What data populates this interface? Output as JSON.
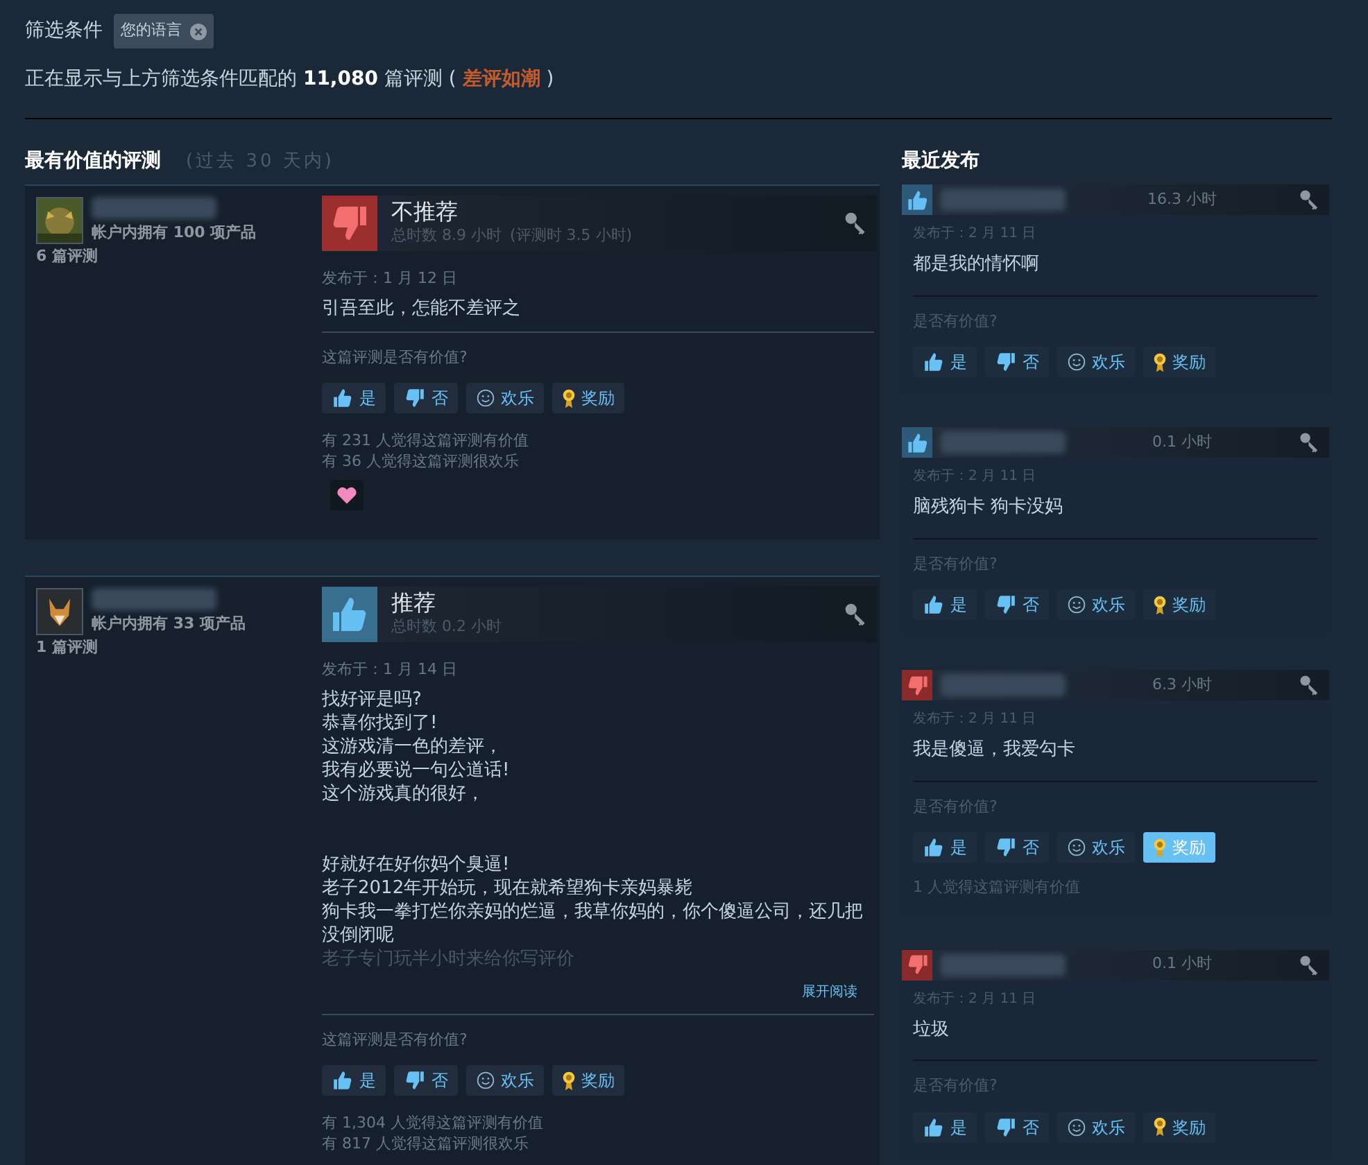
{
  "filter": {
    "label": "筛选条件",
    "chip": "您的语言"
  },
  "summary": {
    "before": "正在显示与上方筛选条件匹配的",
    "count": "11,080",
    "after": "篇评测 (",
    "rating": "差评如潮",
    "close": ")"
  },
  "helpful": {
    "title": "最有价值的评测",
    "period": "(过去 30 天内)",
    "reviews": [
      {
        "products": "帐户内拥有 100 项产品",
        "reviews_count": "6 篇评测",
        "avatar": {
          "kind": "picture"
        },
        "recommended": false,
        "verdict": "不推荐",
        "hours": "总时数 8.9 小时",
        "hours_at_review": "(评测时 3.5 小时)",
        "posted": "发布于：1 月 12 日",
        "paragraphs": [
          [
            "引吾至此，怎能不差评之"
          ]
        ],
        "collapsed": false,
        "question": "这篇评测是否有价值?",
        "votes": [
          {
            "kind": "yes",
            "label": "是",
            "selected": false
          },
          {
            "kind": "no",
            "label": "否",
            "selected": false
          },
          {
            "kind": "funny",
            "label": "欢乐",
            "selected": false
          },
          {
            "kind": "award",
            "label": "奖励",
            "selected": false
          }
        ],
        "stats": [
          "有 231 人觉得这篇评测有价值",
          "有 36 人觉得这篇评测很欢乐"
        ],
        "awards": [
          {
            "kind": "heart"
          }
        ]
      },
      {
        "products": "帐户内拥有 33 项产品",
        "reviews_count": "1 篇评测",
        "avatar": {
          "kind": "picture"
        },
        "recommended": true,
        "verdict": "推荐",
        "hours": "总时数 0.2 小时",
        "posted": "发布于：1 月 14 日",
        "paragraphs": [
          [
            "找好评是吗?",
            "恭喜你找到了!",
            "这游戏清一色的差评，",
            "我有必要说一句公道话!",
            "这个游戏真的很好，"
          ],
          [
            "好就好在好你妈个臭逼!",
            "老子2012年开始玩，现在就希望狗卡亲妈暴毙",
            "狗卡我一拳打烂你亲妈的烂逼，我草你妈的，你个傻逼公司，还几把没倒闭呢",
            "老子专门玩半小时来给你写评价"
          ]
        ],
        "collapsed": true,
        "expand": "展开阅读",
        "question": "这篇评测是否有价值?",
        "votes": [
          {
            "kind": "yes",
            "label": "是",
            "selected": false
          },
          {
            "kind": "no",
            "label": "否",
            "selected": false
          },
          {
            "kind": "funny",
            "label": "欢乐",
            "selected": false
          },
          {
            "kind": "award",
            "label": "奖励",
            "selected": false
          }
        ],
        "stats": [
          "有 1,304 人觉得这篇评测有价值",
          "有 817 人觉得这篇评测很欢乐"
        ]
      }
    ]
  },
  "recent": {
    "title": "最近发布",
    "reviews": [
      {
        "recommended": true,
        "hours": "16.3 小时",
        "posted": "发布于：2 月 11 日",
        "text": "都是我的情怀啊",
        "question": "是否有价值?",
        "votes": [
          {
            "kind": "yes",
            "label": "是",
            "selected": false
          },
          {
            "kind": "no",
            "label": "否",
            "selected": false
          },
          {
            "kind": "funny",
            "label": "欢乐",
            "selected": false
          },
          {
            "kind": "award",
            "label": "奖励",
            "selected": false
          }
        ]
      },
      {
        "recommended": true,
        "hours": "0.1 小时",
        "posted": "发布于：2 月 11 日",
        "text": "脑残狗卡 狗卡没妈",
        "question": "是否有价值?",
        "votes": [
          {
            "kind": "yes",
            "label": "是",
            "selected": false
          },
          {
            "kind": "no",
            "label": "否",
            "selected": false
          },
          {
            "kind": "funny",
            "label": "欢乐",
            "selected": false
          },
          {
            "kind": "award",
            "label": "奖励",
            "selected": false
          }
        ]
      },
      {
        "recommended": false,
        "hours": "6.3 小时",
        "posted": "发布于：2 月 11 日",
        "text": "我是傻逼，我爱勾卡",
        "question": "是否有价值?",
        "votes": [
          {
            "kind": "yes",
            "label": "是",
            "selected": false
          },
          {
            "kind": "no",
            "label": "否",
            "selected": false
          },
          {
            "kind": "funny",
            "label": "欢乐",
            "selected": false
          },
          {
            "kind": "award",
            "label": "奖励",
            "selected": true
          }
        ],
        "stats": [
          "1 人觉得这篇评测有价值"
        ]
      },
      {
        "recommended": false,
        "hours": "0.1 小时",
        "posted": "发布于：2 月 11 日",
        "text": "垃圾",
        "question": "是否有价值?",
        "votes": [
          {
            "kind": "yes",
            "label": "是",
            "selected": false
          },
          {
            "kind": "no",
            "label": "否",
            "selected": false
          },
          {
            "kind": "funny",
            "label": "欢乐",
            "selected": false
          },
          {
            "kind": "award",
            "label": "奖励",
            "selected": false
          }
        ]
      }
    ]
  }
}
